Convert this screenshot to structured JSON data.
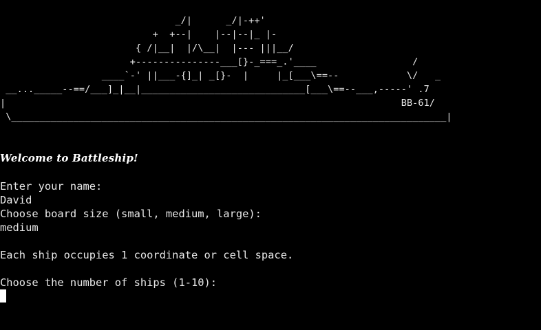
{
  "terminal": {
    "ascii_art": "                               _/|      _/|-++'\n                           +  +--|    |--|--|_ |-\n                        { /|__|  |/\\__|  |--- |||__/\n                       +---------------___[}-_===_.'____                 /\n                  ____`-' ||___-{]_| _[}-  |     |_[___\\==--            \\/   _\n __..._____--==/___]_|__|_____________________________[___\\==--___,-----' .7\n|                                                                      BB-61/\n \\_____________________________________________________________________________|",
    "welcome": "Welcome to Battleship!",
    "name_prompt": "Enter your name:",
    "name_value": "David",
    "board_prompt": "Choose board size (small, medium, large):",
    "board_value": "medium",
    "ship_info": "Each ship occupies 1 coordinate or cell space.",
    "ships_prompt": "Choose the number of ships (1-10):"
  },
  "colors": {
    "background": "#000000",
    "text": "#e8e8e8",
    "cursor": "#ffffff"
  }
}
